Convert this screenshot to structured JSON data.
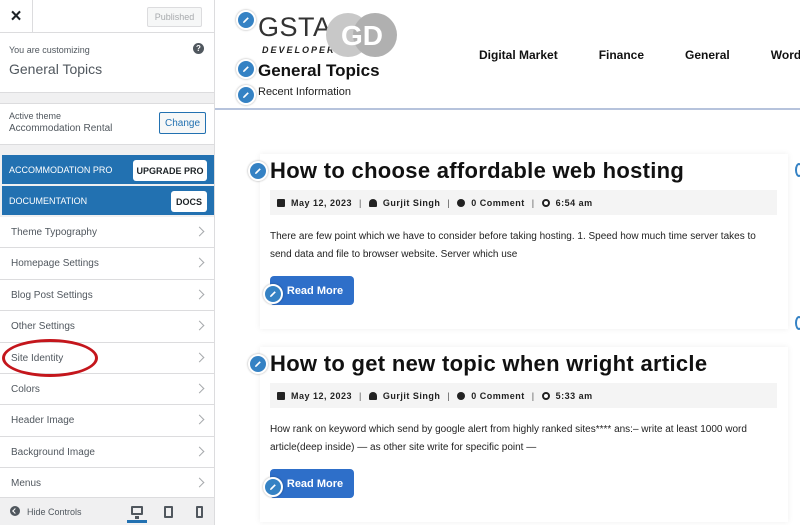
{
  "sidebar": {
    "close_label": "×",
    "published_label": "Published",
    "customizing_label": "You are customizing",
    "section_title": "General Topics",
    "help_label": "?",
    "active_theme_label": "Active theme",
    "active_theme_name": "Accommodation Rental",
    "change_label": "Change",
    "promos": [
      {
        "label": "ACCOMMODATION PRO",
        "button": "UPGRADE PRO"
      },
      {
        "label": "DOCUMENTATION",
        "button": "DOCS"
      }
    ],
    "items": [
      {
        "label": "Theme Typography"
      },
      {
        "label": "Homepage Settings"
      },
      {
        "label": "Blog Post Settings"
      },
      {
        "label": "Other Settings"
      },
      {
        "label": "Site Identity"
      },
      {
        "label": "Colors"
      },
      {
        "label": "Header Image"
      },
      {
        "label": "Background Image"
      },
      {
        "label": "Menus"
      }
    ],
    "hide_controls_label": "Hide Controls",
    "devices": [
      "desktop-icon",
      "tablet-icon",
      "mobile-icon"
    ]
  },
  "preview": {
    "logo": {
      "text": "GSTA",
      "subtext": "DEVELOPER",
      "mark": "GD"
    },
    "site_title": "General Topics",
    "tagline": "Recent Information",
    "nav": [
      "Digital Market",
      "Finance",
      "General",
      "WordPress"
    ],
    "posts": [
      {
        "title": "How to choose affordable web hosting",
        "date": "May 12, 2023",
        "author": "Gurjit Singh",
        "comments": "0 Comment",
        "time": "6:54 am",
        "excerpt": "There are few point which we have to consider before taking hosting. 1. Speed how much time server takes to send data and file to browser website. Server which use",
        "read_more": "Read More"
      },
      {
        "title": "How to get new topic when wright article",
        "date": "May 12, 2023",
        "author": "Gurjit Singh",
        "comments": "0 Comment",
        "time": "5:33 am",
        "excerpt": "How rank on keyword which send by google alert from highly ranked sites**** ans:– write at least 1000 word article(deep inside) — as other site write for specific point —",
        "read_more": "Read More"
      }
    ]
  },
  "colors": {
    "wp_blue": "#2271b1",
    "pencil_blue": "#3582c4",
    "read_more_blue": "#2e6fc9",
    "highlight_red": "#c4161c"
  }
}
